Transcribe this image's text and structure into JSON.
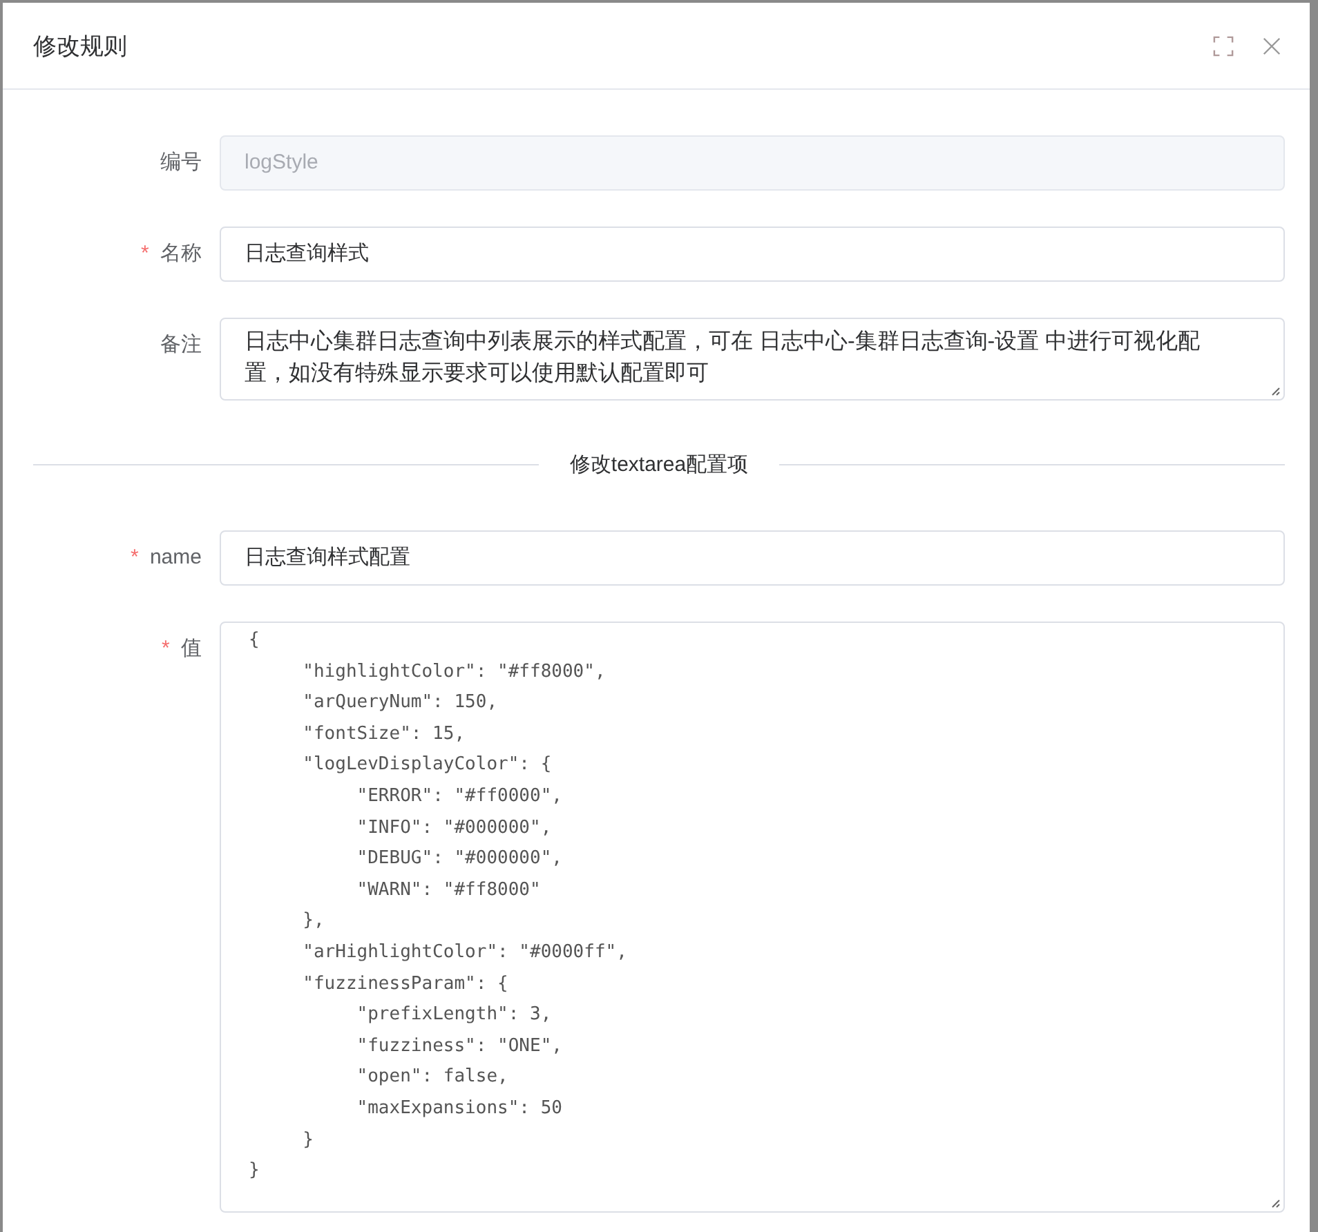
{
  "dialog": {
    "title": "修改规则",
    "buttons": [
      {
        "kind": "fullscreen"
      },
      {
        "kind": "close"
      }
    ]
  },
  "fields": [
    {
      "label": "编号",
      "kind": "input",
      "value": "logStyle",
      "disabled": true
    },
    {
      "label": "名称",
      "required_mark": "*",
      "kind": "input",
      "value": "日志查询样式",
      "disabled": false
    },
    {
      "label": "备注",
      "kind": "textarea",
      "value": "日志中心集群日志查询中列表展示的样式配置，可在 日志中心-集群日志查询-设置 中进行可视化配置，如没有特殊显示要求可以使用默认配置即可",
      "disabled": false
    }
  ],
  "divider": "修改textarea配置项",
  "config_fields": [
    {
      "label": "name",
      "required_mark": "*",
      "kind": "input",
      "value": "日志查询样式配置",
      "disabled": false
    },
    {
      "label": "值",
      "required_mark": "*",
      "kind": "code",
      "value": "{\n\t\"highlightColor\": \"#ff8000\",\n\t\"arQueryNum\": 150,\n\t\"fontSize\": 15,\n\t\"logLevDisplayColor\": {\n\t\t\"ERROR\": \"#ff0000\",\n\t\t\"INFO\": \"#000000\",\n\t\t\"DEBUG\": \"#000000\",\n\t\t\"WARN\": \"#ff8000\"\n\t},\n\t\"arHighlightColor\": \"#0000ff\",\n\t\"fuzzinessParam\": {\n\t\t\"prefixLength\": 3,\n\t\t\"fuzziness\": \"ONE\",\n\t\t\"open\": false,\n\t\t\"maxExpansions\": 50\n\t}\n}",
      "disabled": false
    }
  ]
}
